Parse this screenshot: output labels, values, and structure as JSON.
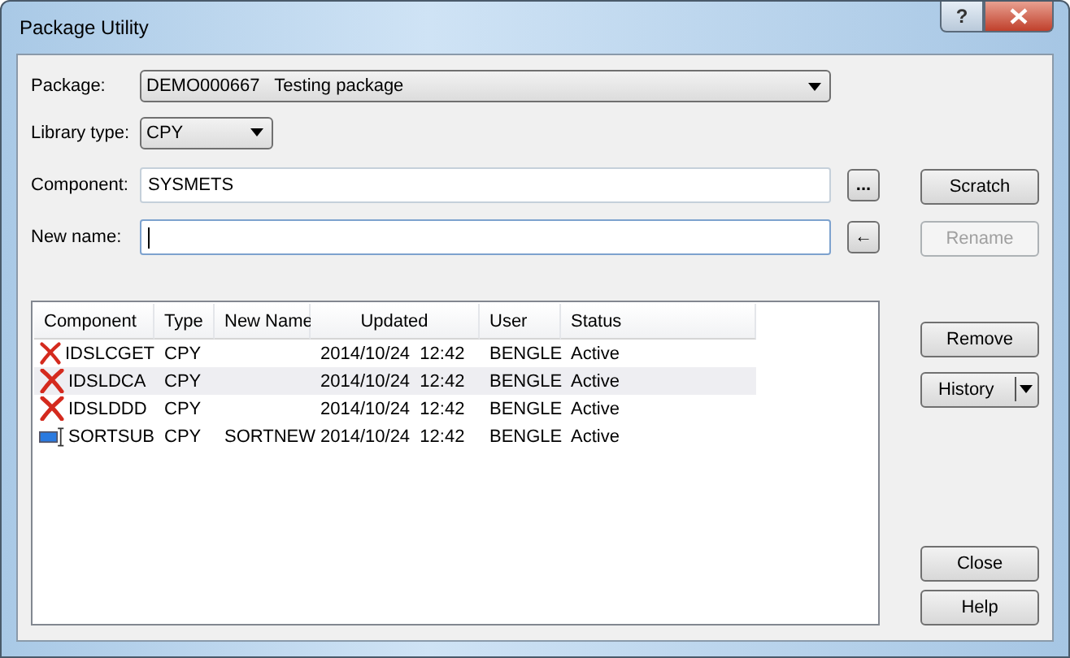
{
  "window": {
    "title": "Package Utility",
    "help_glyph": "?"
  },
  "package": {
    "label": "Package:",
    "value": "DEMO000667   Testing package"
  },
  "library_type": {
    "label": "Library type:",
    "value": "CPY"
  },
  "component": {
    "label": "Component:",
    "value": "SYSMETS",
    "browse": "..."
  },
  "new_name": {
    "label": "New name:",
    "apply": "←"
  },
  "table": {
    "columns": [
      "Component",
      "Type",
      "New Name",
      "Updated",
      "User",
      "Status"
    ],
    "rows": [
      {
        "kind": "delete",
        "selected": false,
        "cells": [
          "IDSLCGET",
          "CPY",
          "",
          "2014/10/24  12:42",
          "BENGLE",
          "Active"
        ]
      },
      {
        "kind": "delete",
        "selected": true,
        "cells": [
          "IDSLDCA",
          "CPY",
          "",
          "2014/10/24  12:42",
          "BENGLE",
          "Active"
        ]
      },
      {
        "kind": "delete",
        "selected": false,
        "cells": [
          "IDSLDDD",
          "CPY",
          "",
          "2014/10/24  12:42",
          "BENGLE",
          "Active"
        ]
      },
      {
        "kind": "rename",
        "selected": false,
        "cells": [
          "SORTSUB",
          "CPY",
          "SORTNEW",
          "2014/10/24  12:42",
          "BENGLE",
          "Active"
        ]
      }
    ]
  },
  "buttons": {
    "scratch": {
      "label": "Scratch",
      "disabled": false
    },
    "rename": {
      "label": "Rename",
      "disabled": true
    },
    "remove": {
      "label": "Remove",
      "disabled": false
    },
    "history": {
      "label": "History",
      "disabled": false
    },
    "close": {
      "label": "Close",
      "disabled": false
    },
    "help": {
      "label": "Help",
      "disabled": false
    }
  }
}
